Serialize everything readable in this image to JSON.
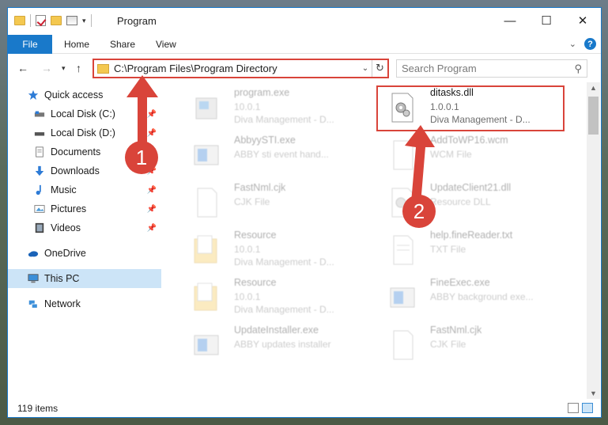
{
  "window": {
    "title": "Program",
    "minimize": "—",
    "maximize": "☐",
    "close": "✕"
  },
  "ribbon": {
    "tabs": [
      "File",
      "Home",
      "Share",
      "View"
    ],
    "help": "?"
  },
  "address": {
    "path": "C:\\Program Files\\Program Directory"
  },
  "search": {
    "placeholder": "Search Program"
  },
  "nav": {
    "items": [
      {
        "label": "Quick access",
        "icon": "star-icon"
      },
      {
        "label": "Local Disk (C:)",
        "icon": "drive-icon",
        "pinned": true
      },
      {
        "label": "Local Disk (D:)",
        "icon": "drive-icon",
        "pinned": true
      },
      {
        "label": "Documents",
        "icon": "documents-icon",
        "pinned": true
      },
      {
        "label": "Downloads",
        "icon": "downloads-icon",
        "pinned": true
      },
      {
        "label": "Music",
        "icon": "music-icon",
        "pinned": true
      },
      {
        "label": "Pictures",
        "icon": "pictures-icon",
        "pinned": true
      },
      {
        "label": "Videos",
        "icon": "videos-icon",
        "pinned": true
      },
      {
        "label": "OneDrive",
        "icon": "cloud-icon"
      },
      {
        "label": "This PC",
        "icon": "computer-icon",
        "selected": true
      },
      {
        "label": "Network",
        "icon": "network-icon"
      }
    ]
  },
  "files": [
    {
      "name": "program.exe",
      "line1": "10.0.1",
      "line2": "Diva Management - D...",
      "icon": "exe-icon"
    },
    {
      "name": "ditasks.dll",
      "line1": "1.0.0.1",
      "line2": "Diva Management - D...",
      "icon": "dll-gear-icon",
      "highlighted": true
    },
    {
      "name": "AbbyySTI.exe",
      "line1": "ABBY sti event hand...",
      "line2": "",
      "icon": "app-icon"
    },
    {
      "name": "AddToWP16.wcm",
      "line1": "WCM File",
      "line2": "",
      "icon": "blank-file-icon"
    },
    {
      "name": "FastNml.cjk",
      "line1": "CJK File",
      "line2": "",
      "icon": "blank-file-icon"
    },
    {
      "name": "UpdateClient21.dll",
      "line1": "Resource DLL",
      "line2": "",
      "icon": "dll-gear-icon"
    },
    {
      "name": "Resource",
      "line1": "10.0.1",
      "line2": "Diva Management - D...",
      "icon": "folder-doc-icon"
    },
    {
      "name": "help.fineReader.txt",
      "line1": "TXT File",
      "line2": "",
      "icon": "text-file-icon"
    },
    {
      "name": "Resource",
      "line1": "10.0.1",
      "line2": "Diva Management - D...",
      "icon": "folder-doc-icon"
    },
    {
      "name": "FineExec.exe",
      "line1": "ABBY background exe...",
      "line2": "",
      "icon": "app-icon"
    },
    {
      "name": "UpdateInstaller.exe",
      "line1": "ABBY updates installer",
      "line2": "",
      "icon": "app-icon"
    },
    {
      "name": "FastNml.cjk",
      "line1": "CJK File",
      "line2": "",
      "icon": "blank-file-icon"
    }
  ],
  "status": {
    "count": "119 items"
  },
  "callouts": [
    "1",
    "2"
  ],
  "accent": "#1979ca",
  "annotation_color": "#d9443a"
}
